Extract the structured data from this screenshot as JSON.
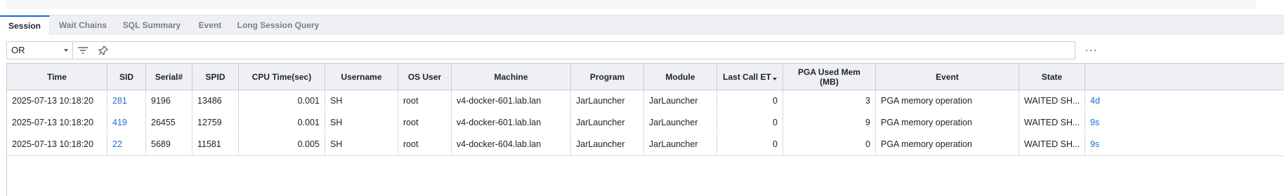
{
  "tabs": [
    {
      "label": "Session",
      "active": true
    },
    {
      "label": "Wait Chains",
      "active": false
    },
    {
      "label": "SQL Summary",
      "active": false
    },
    {
      "label": "Event",
      "active": false
    },
    {
      "label": "Long Session Query",
      "active": false
    }
  ],
  "filter": {
    "operator": "OR",
    "filter_icon": "filter-lines-icon",
    "pin_icon": "pin-icon",
    "more_icon": "more-dots-icon"
  },
  "table": {
    "columns": [
      "Time",
      "SID",
      "Serial#",
      "SPID",
      "CPU Time(sec)",
      "Username",
      "OS User",
      "Machine",
      "Program",
      "Module",
      "Last Call ET",
      "PGA Used Mem (MB)",
      "Event",
      "State",
      ""
    ],
    "sorted_column": "Last Call ET",
    "rows": [
      [
        "2025-07-13 10:18:20",
        "281",
        "9196",
        "13486",
        "0.001",
        "SH",
        "root",
        "v4-docker-601.lab.lan",
        "JarLauncher",
        "JarLauncher",
        "0",
        "3",
        "PGA memory operation",
        "WAITED SH...",
        "4d"
      ],
      [
        "2025-07-13 10:18:20",
        "419",
        "26455",
        "12759",
        "0.001",
        "SH",
        "root",
        "v4-docker-601.lab.lan",
        "JarLauncher",
        "JarLauncher",
        "0",
        "9",
        "PGA memory operation",
        "WAITED SH...",
        "9s"
      ],
      [
        "2025-07-13 10:18:20",
        "22",
        "5689",
        "11581",
        "0.005",
        "SH",
        "root",
        "v4-docker-604.lab.lan",
        "JarLauncher",
        "JarLauncher",
        "0",
        "0",
        "PGA memory operation",
        "WAITED SH...",
        "9s"
      ]
    ]
  },
  "colors": {
    "accent": "#1a6fd6",
    "header_bg": "#eef0f3",
    "border": "#c9cdd3"
  }
}
